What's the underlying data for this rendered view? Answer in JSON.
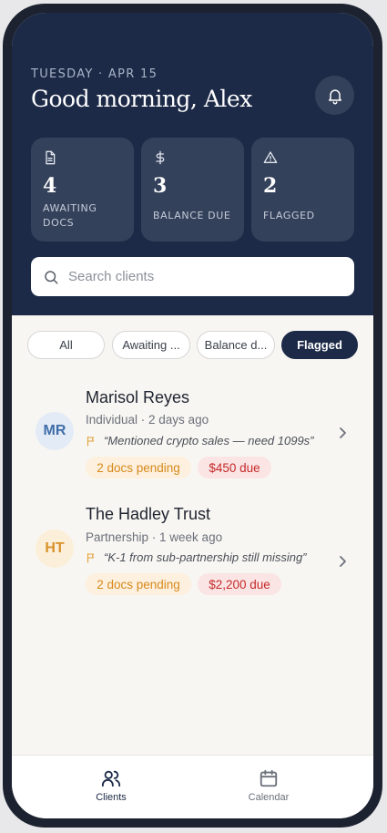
{
  "header": {
    "date": "TUESDAY · APR 15",
    "greeting": "Good morning, Alex"
  },
  "stats": [
    {
      "icon": "document-icon",
      "value": "4",
      "label": "AWAITING DOCS"
    },
    {
      "icon": "dollar-icon",
      "value": "3",
      "label": "BALANCE DUE"
    },
    {
      "icon": "warning-icon",
      "value": "2",
      "label": "FLAGGED"
    }
  ],
  "search": {
    "placeholder": "Search clients"
  },
  "filters": [
    {
      "label": "All",
      "active": false
    },
    {
      "label": "Awaiting ...",
      "active": false
    },
    {
      "label": "Balance d...",
      "active": false
    },
    {
      "label": "Flagged",
      "active": true
    }
  ],
  "clients": [
    {
      "initials": "MR",
      "name": "Marisol Reyes",
      "meta": "Individual · 2 days ago",
      "note": "“Mentioned crypto sales — need 1099s”",
      "docs_badge": "2 docs pending",
      "due_badge": "$450 due",
      "avatar_bg": "#e3ebf6",
      "avatar_fg": "#3f6ea8"
    },
    {
      "initials": "HT",
      "name": "The Hadley Trust",
      "meta": "Partnership · 1 week ago",
      "note": "“K-1 from sub-partnership still missing”",
      "docs_badge": "2 docs pending",
      "due_badge": "$2,200 due",
      "avatar_bg": "#fcefd9",
      "avatar_fg": "#d8912a"
    }
  ],
  "tabs": [
    {
      "label": "Clients",
      "icon": "users-icon",
      "active": true
    },
    {
      "label": "Calendar",
      "icon": "calendar-icon",
      "active": false
    }
  ],
  "colors": {
    "navy": "#1c2a47",
    "accent_orange": "#d68a1c",
    "accent_red": "#c42a2a"
  }
}
